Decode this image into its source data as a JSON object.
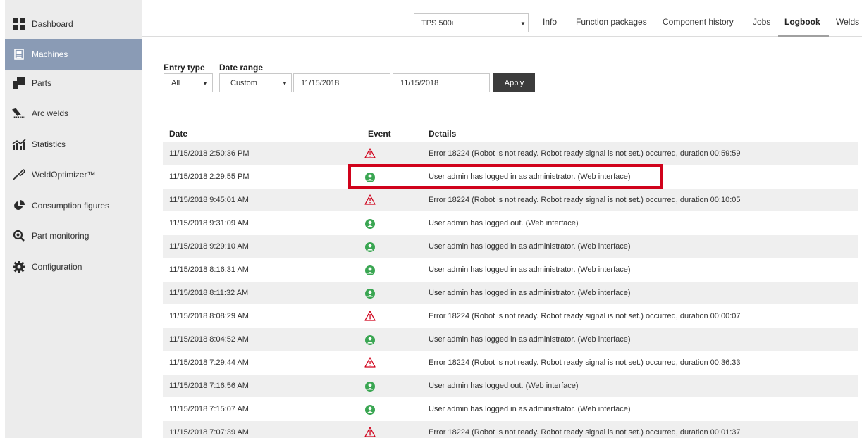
{
  "sidebar": {
    "items": [
      {
        "label": "Dashboard",
        "icon": "dashboard-icon",
        "active": false
      },
      {
        "label": "Machines",
        "icon": "machine-icon",
        "active": true
      },
      {
        "label": "Parts",
        "icon": "parts-icon",
        "active": false
      },
      {
        "label": "Arc welds",
        "icon": "arc-weld-icon",
        "active": false
      },
      {
        "label": "Statistics",
        "icon": "statistics-icon",
        "active": false
      },
      {
        "label": "WeldOptimizer™",
        "icon": "weld-optimizer-icon",
        "active": false
      },
      {
        "label": "Consumption figures",
        "icon": "pie-chart-icon",
        "active": false
      },
      {
        "label": "Part monitoring",
        "icon": "magnifier-icon",
        "active": false
      },
      {
        "label": "Configuration",
        "icon": "gear-icon",
        "active": false
      }
    ]
  },
  "topbar": {
    "machine_select": "TPS 500i",
    "tabs": [
      "Info",
      "Function packages",
      "Component history",
      "Jobs",
      "Logbook",
      "Welds"
    ],
    "active_tab": "Logbook"
  },
  "filters": {
    "entry_type_label": "Entry type",
    "entry_type_value": "All",
    "date_range_label": "Date range",
    "date_range_value": "Custom",
    "date_from": "11/15/2018",
    "date_to": "11/15/2018",
    "apply_label": "Apply"
  },
  "table": {
    "headers": {
      "date": "Date",
      "event": "Event",
      "details": "Details"
    },
    "rows": [
      {
        "date": "11/15/2018 2:50:36 PM",
        "event": "error",
        "details": "Error 18224 (Robot is not ready. Robot ready signal is not set.) occurred, duration 00:59:59"
      },
      {
        "date": "11/15/2018 2:29:55 PM",
        "event": "user",
        "details": "User admin has logged in as administrator. (Web interface)"
      },
      {
        "date": "11/15/2018 9:45:01 AM",
        "event": "error",
        "details": "Error 18224 (Robot is not ready. Robot ready signal is not set.) occurred, duration 00:10:05"
      },
      {
        "date": "11/15/2018 9:31:09 AM",
        "event": "user",
        "details": "User admin has logged out. (Web interface)"
      },
      {
        "date": "11/15/2018 9:29:10 AM",
        "event": "user",
        "details": "User admin has logged in as administrator. (Web interface)"
      },
      {
        "date": "11/15/2018 8:16:31 AM",
        "event": "user",
        "details": "User admin has logged in as administrator. (Web interface)"
      },
      {
        "date": "11/15/2018 8:11:32 AM",
        "event": "user",
        "details": "User admin has logged in as administrator. (Web interface)"
      },
      {
        "date": "11/15/2018 8:08:29 AM",
        "event": "error",
        "details": "Error 18224 (Robot is not ready. Robot ready signal is not set.) occurred, duration 00:00:07"
      },
      {
        "date": "11/15/2018 8:04:52 AM",
        "event": "user",
        "details": "User admin has logged in as administrator. (Web interface)"
      },
      {
        "date": "11/15/2018 7:29:44 AM",
        "event": "error",
        "details": "Error 18224 (Robot is not ready. Robot ready signal is not set.) occurred, duration 00:36:33"
      },
      {
        "date": "11/15/2018 7:16:56 AM",
        "event": "user",
        "details": "User admin has logged out. (Web interface)"
      },
      {
        "date": "11/15/2018 7:15:07 AM",
        "event": "user",
        "details": "User admin has logged in as administrator. (Web interface)"
      },
      {
        "date": "11/15/2018 7:07:39 AM",
        "event": "error",
        "details": "Error 18224 (Robot is not ready. Robot ready signal is not set.) occurred, duration 00:01:37"
      }
    ]
  },
  "colors": {
    "sidebar_bg": "#ececec",
    "sidebar_active": "#8a9bb5",
    "error_icon": "#d0021b",
    "user_icon": "#3aa652",
    "highlight_border": "#d0021b",
    "apply_bg": "#3c3c3c"
  }
}
